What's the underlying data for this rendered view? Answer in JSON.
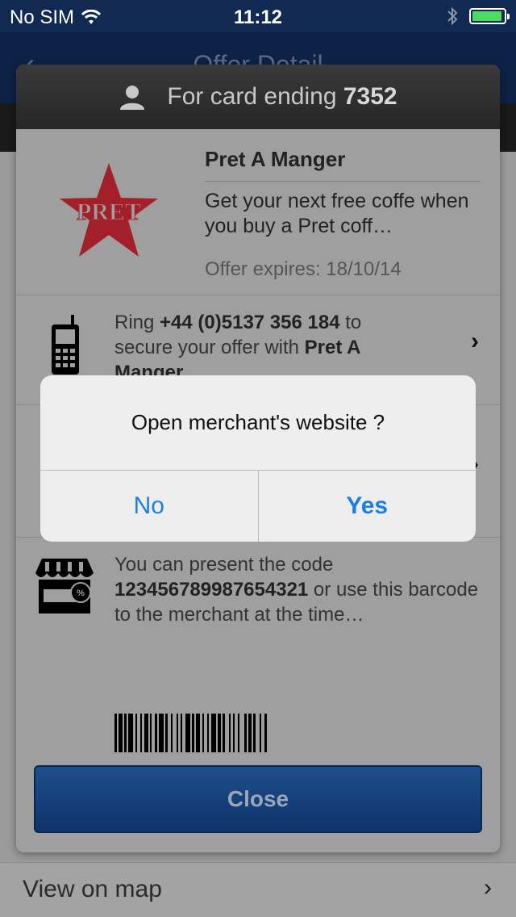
{
  "status_bar": {
    "carrier": "No SIM",
    "time": "11:12",
    "battery_level": 0.95,
    "accent": "#4cd964"
  },
  "background": {
    "nav_title": "Offer Detail",
    "view_on_map": "View on map"
  },
  "card": {
    "header_prefix": "For card ending ",
    "card_last_digits": "7352",
    "merchant": {
      "name": "Pret A Manger",
      "description": "Get your next free coffe when you buy a Pret coff…",
      "expiry": "Offer expires: 18/10/14",
      "logo_text": "PRET",
      "logo_color": "#a3202b"
    },
    "phone": {
      "text_before": "Ring ",
      "number": "+44 (0)5137 356 184",
      "text_middle": " to secure your offer with ",
      "merchant": "Pret A Manger"
    },
    "store": {
      "text_before": "You can present the code ",
      "code": "12345678998765432 1",
      "code_display": "123456789987654321",
      "text_after": " or use this barcode to the merchant at the time…"
    },
    "close_label": "Close"
  },
  "alert": {
    "message": "Open merchant's website ?",
    "no_label": "No",
    "yes_label": "Yes",
    "button_color": "#1a7fe6"
  }
}
